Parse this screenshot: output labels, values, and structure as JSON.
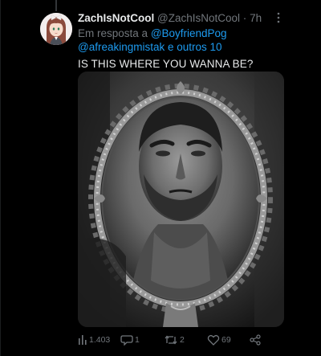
{
  "tweet": {
    "display_name": "ZachIsNotCool",
    "handle": "@ZachIsNotCool",
    "separator": "·",
    "time": "7h",
    "reply_prefix": "Em resposta a",
    "reply_mention_1": "@BoyfriendPog",
    "reply_mention_2": "@afreakingmistak",
    "reply_suffix": "e outros 10",
    "text": "IS THIS WHERE YOU WANNA BE?"
  },
  "actions": {
    "views": "1.403",
    "replies": "1",
    "retweets": "2",
    "likes": "69"
  },
  "icons": {
    "more": "more-icon",
    "views": "bar-chart-icon",
    "reply": "reply-icon",
    "retweet": "retweet-icon",
    "like": "heart-icon",
    "share": "share-icon"
  },
  "colors": {
    "background": "#000000",
    "text": "#e7e9ea",
    "secondary": "#71767b",
    "accent": "#1d9bf0",
    "retweet_active": "#71767b"
  }
}
